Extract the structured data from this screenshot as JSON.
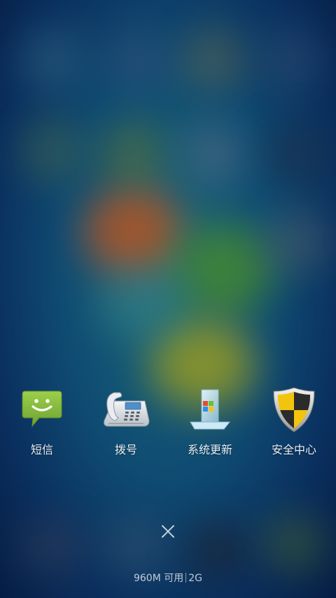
{
  "apps": [
    {
      "label": "短信",
      "icon": "message-icon"
    },
    {
      "label": "拨号",
      "icon": "telephone-icon"
    },
    {
      "label": "系统更新",
      "icon": "system-update-icon"
    },
    {
      "label": "安全中心",
      "icon": "security-shield-icon"
    }
  ],
  "memory": {
    "available": "960M 可用",
    "total": "2G"
  },
  "colors": {
    "message_green": "#7fb33c",
    "shield_yellow": "#f3c40e",
    "shield_dark": "#2b2b2b"
  }
}
